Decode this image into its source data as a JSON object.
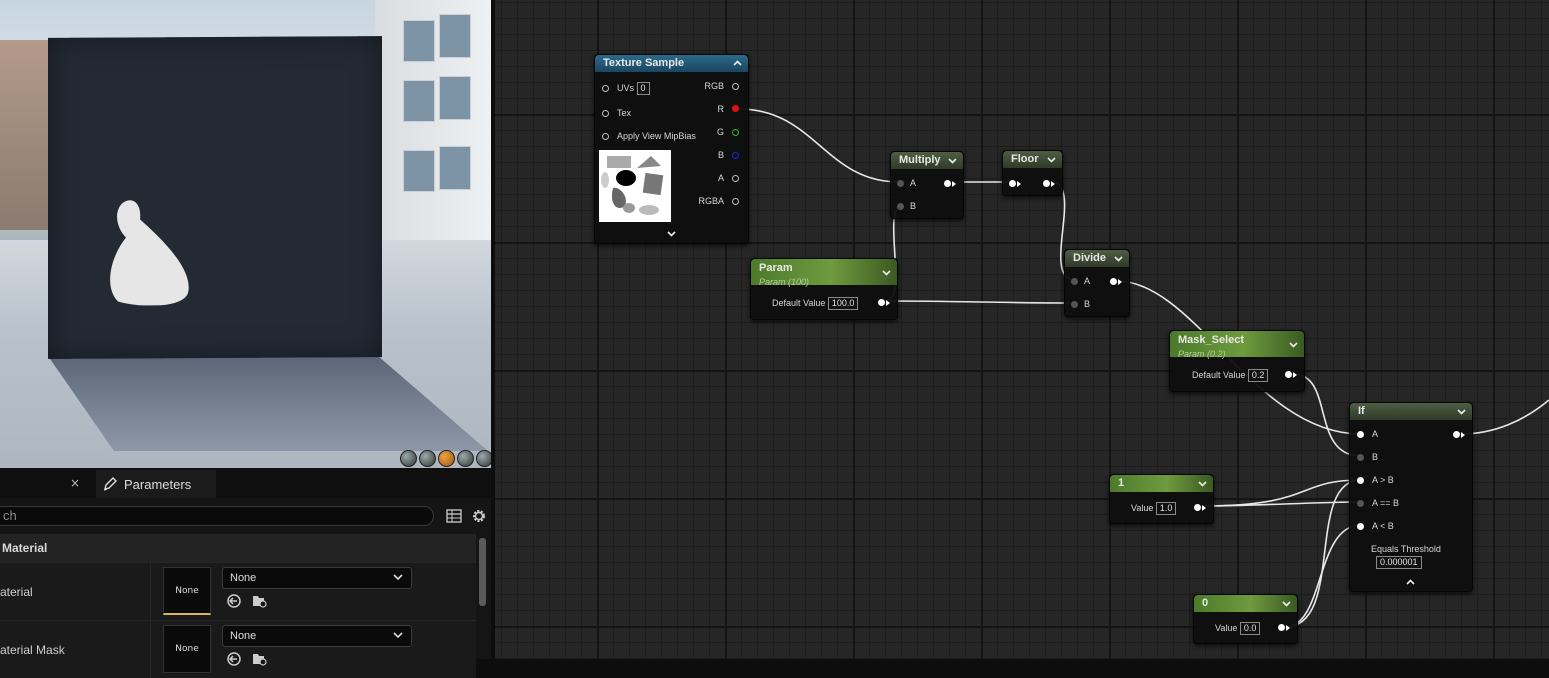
{
  "details": {
    "tab_close": "×",
    "tab_label": "Parameters",
    "search_placeholder": "ch",
    "category": "Material",
    "rows": [
      {
        "label": "aterial",
        "thumb": "None",
        "combo": "None"
      },
      {
        "label": "aterial Mask",
        "thumb": "None",
        "combo": "None"
      }
    ]
  },
  "graph": {
    "texture_sample": {
      "title": "Texture Sample",
      "inputs": {
        "uvs": "UVs",
        "uvs_value": "0",
        "tex": "Tex",
        "mip": "Apply View MipBias"
      },
      "outputs": [
        "RGB",
        "R",
        "G",
        "B",
        "A",
        "RGBA"
      ]
    },
    "multiply": {
      "title": "Multiply",
      "a": "A",
      "b": "B"
    },
    "floor": {
      "title": "Floor"
    },
    "divide": {
      "title": "Divide",
      "a": "A",
      "b": "B"
    },
    "param": {
      "title": "Param",
      "subtitle": "Param (100)",
      "label": "Default Value",
      "value": "100.0"
    },
    "mask_select": {
      "title": "Mask_Select",
      "subtitle": "Param (0.2)",
      "label": "Default Value",
      "value": "0.2"
    },
    "const_one": {
      "title": "1",
      "label": "Value",
      "value": "1.0"
    },
    "const_zero": {
      "title": "0",
      "label": "Value",
      "value": "0.0"
    },
    "if_node": {
      "title": "If",
      "pins": [
        "A",
        "B",
        "A > B",
        "A == B",
        "A < B"
      ],
      "threshold_label": "Equals Threshold",
      "threshold_value": "0.000001"
    }
  },
  "colors": {
    "pin_r": "#e01010",
    "pin_g": "#20c020",
    "pin_b": "#1010c0",
    "accent": "#f0a040"
  }
}
